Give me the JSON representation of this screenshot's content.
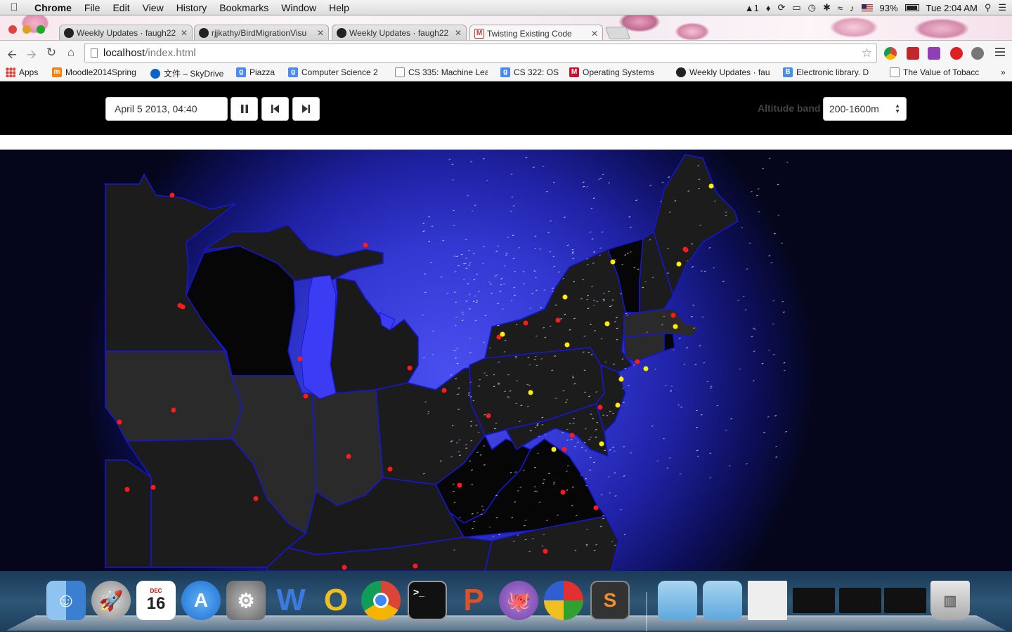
{
  "menubar": {
    "app_name": "Chrome",
    "menus": [
      "File",
      "Edit",
      "View",
      "History",
      "Bookmarks",
      "Window",
      "Help"
    ],
    "status": {
      "adobe_count": "1",
      "battery": "93%",
      "clock": "Tue 2:04 AM"
    }
  },
  "tabs": [
    {
      "title": "Weekly Updates · faugh22",
      "icon": "github-icon",
      "active": false
    },
    {
      "title": "rjjkathy/BirdMigrationVisu",
      "icon": "github-icon",
      "active": false
    },
    {
      "title": "Weekly Updates · faugh22",
      "icon": "github-icon",
      "active": false
    },
    {
      "title": "Twisting Existing Code",
      "icon": "gmail-icon",
      "active": true
    }
  ],
  "omnibox": {
    "host": "localhost",
    "path": "/index.html"
  },
  "bookmarks": [
    {
      "label": "Apps",
      "icon": "apps-grid-icon",
      "color": "#4285f4"
    },
    {
      "label": "Moodle2014Spring",
      "icon": "moodle-icon",
      "color": "#f98012"
    },
    {
      "label": "文件 – SkyDrive",
      "icon": "skydrive-icon",
      "color": "#0a64c8"
    },
    {
      "label": "Piazza",
      "icon": "google-icon",
      "color": "#4a8af4"
    },
    {
      "label": "Computer Science 2",
      "icon": "google-icon",
      "color": "#4a8af4"
    },
    {
      "label": "CS 335: Machine Lea",
      "icon": "page-icon",
      "color": "#ffffff"
    },
    {
      "label": "CS 322: OS",
      "icon": "google-icon",
      "color": "#4a8af4"
    },
    {
      "label": "Operating Systems",
      "icon": "mcgraw-icon",
      "color": "#c41230"
    },
    {
      "label": "Weekly Updates · fau",
      "icon": "github-icon",
      "color": "#222222"
    },
    {
      "label": "Electronic library. D",
      "icon": "bf-icon",
      "color": "#4a90d9"
    },
    {
      "label": "The Value of Tobacc",
      "icon": "page-icon",
      "color": "#ffffff"
    }
  ],
  "controls": {
    "date_value": "April 5 2013, 04:40",
    "pause_icon": "pause-icon",
    "prev_icon": "step-back-icon",
    "next_icon": "step-forward-icon",
    "altitude_label": "Altitude band",
    "altitude_value": "200-1600m"
  },
  "map": {
    "colors": {
      "state": "#1e1e1e",
      "border": "#1616d8",
      "lake": "#3c3cf5",
      "red_site": "#ff1a1a",
      "yellow_site": "#ffef00",
      "birds": "#d8d8ff"
    },
    "radar_sites_red": 37,
    "radar_sites_yellow": 14
  },
  "dock": {
    "apps": [
      "Finder",
      "Launchpad",
      "Calendar",
      "App Store",
      "System Preferences",
      "Word",
      "Outlook",
      "Chrome",
      "Terminal",
      "PowerPoint",
      "GitHub",
      "CrossOver",
      "Sublime Text"
    ],
    "calendar_day": "16",
    "calendar_month": "DEC"
  }
}
